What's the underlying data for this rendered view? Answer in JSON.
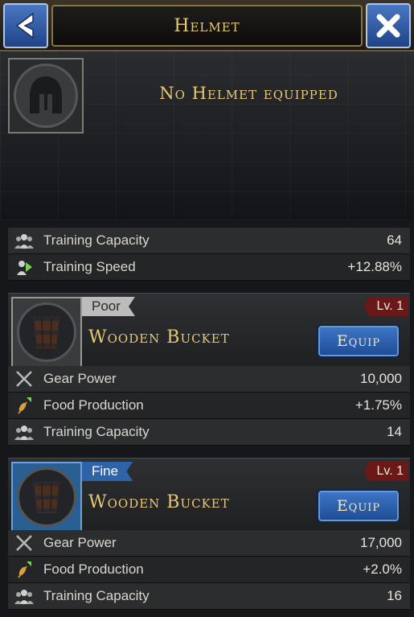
{
  "header": {
    "title": "Helmet",
    "back_icon": "chevron-left-icon",
    "close_icon": "close-icon"
  },
  "equipped": {
    "empty_message": "No Helmet equipped",
    "slot_icon": "helmet-icon"
  },
  "current_stats": [
    {
      "icon": "troops-icon",
      "label": "Training Capacity",
      "value": "64"
    },
    {
      "icon": "training-speed-icon",
      "label": "Training Speed",
      "value": "+12.88%"
    }
  ],
  "items": [
    {
      "quality": "Poor",
      "level": "Lv. 1",
      "name": "Wooden Bucket",
      "equip_label": "Equip",
      "stats": [
        {
          "icon": "swords-icon",
          "label": "Gear Power",
          "value": "10,000"
        },
        {
          "icon": "wheat-icon",
          "label": "Food Production",
          "value": "+1.75%"
        },
        {
          "icon": "troops-icon",
          "label": "Training Capacity",
          "value": "14"
        }
      ]
    },
    {
      "quality": "Fine",
      "level": "Lv. 1",
      "name": "Wooden Bucket",
      "equip_label": "Equip",
      "stats": [
        {
          "icon": "swords-icon",
          "label": "Gear Power",
          "value": "17,000"
        },
        {
          "icon": "wheat-icon",
          "label": "Food Production",
          "value": "+2.0%"
        },
        {
          "icon": "troops-icon",
          "label": "Training Capacity",
          "value": "16"
        }
      ]
    }
  ],
  "colors": {
    "gold_text": "#e8c874",
    "blue_button": "#2e63a8",
    "poor_quality": "#bcbcbc",
    "fine_quality": "#2e63a8",
    "level_badge": "#6a1818"
  }
}
